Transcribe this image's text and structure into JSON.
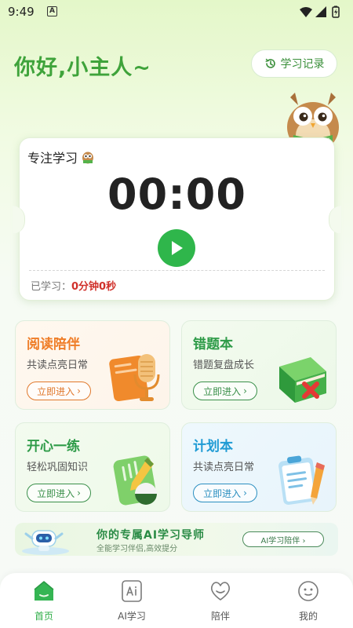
{
  "status_bar": {
    "time": "9:49",
    "notification_icon": "A"
  },
  "header": {
    "greeting": "你好,小主人~",
    "history_button": "学习记录"
  },
  "focus": {
    "title": "专注学习",
    "timer": "00:00",
    "studied_label": "已学习：",
    "studied_value": "0分钟0秒"
  },
  "features": [
    {
      "title": "阅读陪伴",
      "subtitle": "共读点亮日常",
      "enter": "立即进入"
    },
    {
      "title": "错题本",
      "subtitle": "错题复盘成长",
      "enter": "立即进入"
    },
    {
      "title": "开心一练",
      "subtitle": "轻松巩固知识",
      "enter": "立即进入"
    },
    {
      "title": "计划本",
      "subtitle": "共读点亮日常",
      "enter": "立即进入"
    }
  ],
  "ai_banner": {
    "title": "你的专属AI学习导师",
    "subtitle": "全能学习伴侣,高效提分",
    "button": "AI学习陪伴 ›"
  },
  "nav": [
    {
      "label": "首页",
      "icon": "home-icon",
      "active": true
    },
    {
      "label": "AI学习",
      "icon": "ai-icon",
      "active": false
    },
    {
      "label": "陪伴",
      "icon": "heart-icon",
      "active": false
    },
    {
      "label": "我的",
      "icon": "face-icon",
      "active": false
    }
  ],
  "colors": {
    "brand_green": "#3fa33b",
    "play_green": "#2fb64b",
    "studied_red": "#d0302a",
    "read_orange": "#ef7d27",
    "plan_blue": "#1f9bd4"
  }
}
